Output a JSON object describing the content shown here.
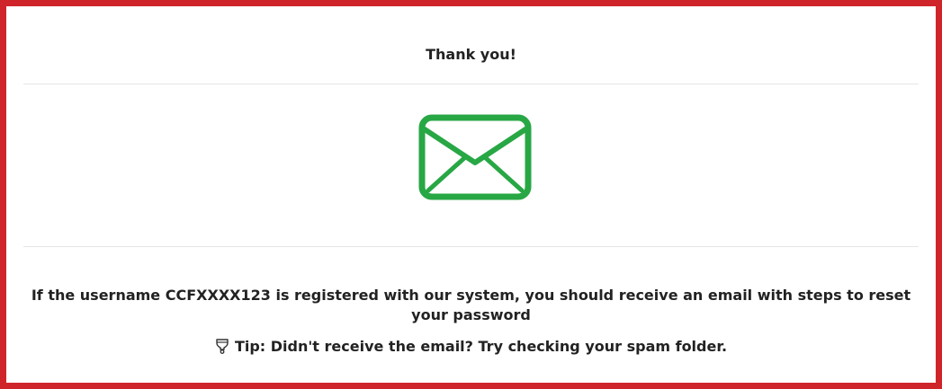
{
  "dialog": {
    "title": "Thank you!",
    "icon": "envelope-icon",
    "icon_color": "#28a745",
    "border_color": "#d0242b",
    "message": "If the username CCFXXXX123 is registered with our system, you should receive an email with steps to reset your password",
    "tip_icon": "lightbulb-icon",
    "tip": "Tip: Didn't receive the email? Try checking your spam folder."
  }
}
